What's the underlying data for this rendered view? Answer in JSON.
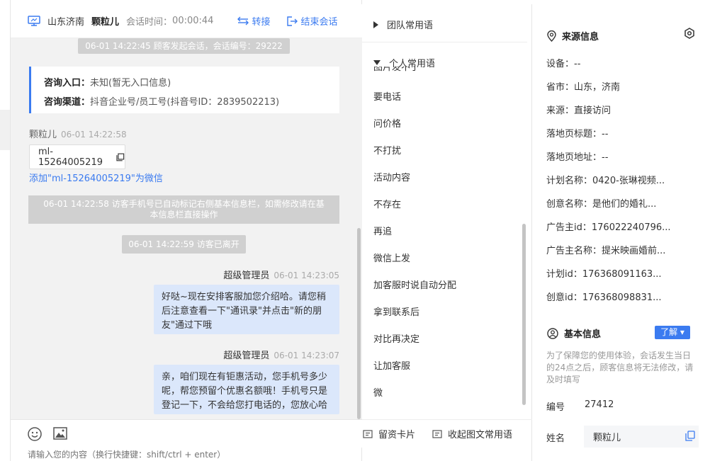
{
  "header": {
    "location": "山东济南",
    "visitor_name": "颗粒儿",
    "session_time_label": "会话时间：",
    "session_time": "00:00:44",
    "transfer_label": "转接",
    "end_label": "结束会话"
  },
  "chat": {
    "start_notice": "06-01 14:22:45 顾客发起会话，会话编号：29222",
    "info_card": {
      "entry_key": "咨询入口：",
      "entry_val": "未知(暂无入口信息)",
      "channel_key": "咨询渠道：",
      "channel_val": "抖音企业号/员工号(抖音号ID：2839502213)"
    },
    "visitor_msg": {
      "sender": "颗粒儿",
      "time": "06-01 14:22:58",
      "text": "ml-15264005219",
      "add_wechat": "添加\"ml-15264005219\"为微信"
    },
    "auto_notice_line1": "06-01 14:22:58 访客手机号已自动标记右侧基本信息栏，如需修改请在基",
    "auto_notice_line2": "本信息栏直接操作",
    "left_notice": "06-01 14:22:59 访客已离开",
    "agent_msgs": [
      {
        "sender": "超级管理员",
        "time": "06-01 14:23:05",
        "text": "好哒~现在安排客服加您介绍哈。请您稍后注意查看一下\"通讯录\"并点击\"新的朋友\"通过下哦"
      },
      {
        "sender": "超级管理员",
        "time": "06-01 14:23:07",
        "text": "亲，咱们现在有钜惠活动，您手机号多少呢，帮您预留个优惠名额哦！手机号只是登记一下，不会给您打电话的，您放心哈"
      }
    ],
    "input_placeholder": "请输入您的内容（换行快捷键：shift/ctrl + enter）"
  },
  "phrases": {
    "team_label": "团队常用语",
    "personal_label": "个人常用语",
    "clipped_item": "图片发不了",
    "items": [
      "要电话",
      "问价格",
      "不打扰",
      "活动内容",
      "不存在",
      "再追",
      "微信上发",
      "加客服时说自动分配",
      "拿到联系后",
      "对比再决定",
      "让加客服",
      "微"
    ],
    "card_btn": "留资卡片",
    "collapse_btn": "收起图文常用语"
  },
  "source_info": {
    "title": "来源信息",
    "rows": [
      {
        "label": "设备：",
        "value": "--"
      },
      {
        "label": "省市：",
        "value": "山东，济南"
      },
      {
        "label": "来源：",
        "value": "直接访问"
      },
      {
        "label": "落地页标题：",
        "value": "--"
      },
      {
        "label": "落地页地址：",
        "value": "--"
      },
      {
        "label": "计划名称：",
        "value": "0420-张琳视频..."
      },
      {
        "label": "创意名称：",
        "value": "是他们的婚礼..."
      },
      {
        "label": "广告主id：",
        "value": "176022240796..."
      },
      {
        "label": "广告主名称：",
        "value": "提米映画婚前..."
      },
      {
        "label": "计划id：",
        "value": "176368091163..."
      },
      {
        "label": "创意id：",
        "value": "176368098831..."
      }
    ]
  },
  "basic_info": {
    "title": "基本信息",
    "know_btn": "了解",
    "hint": "为了保障您的使用体验，会话发生当日的24点之后，顾客信息将无法修改，请及时填写",
    "id_label": "编号",
    "id_value": "27412",
    "name_label": "姓名",
    "name_value": "颗粒儿"
  },
  "colors": {
    "accent": "#3b7bf0",
    "bubble": "#dbe7fb",
    "notice": "#d0d0d0",
    "chat_bg": "#f2f2f2"
  }
}
